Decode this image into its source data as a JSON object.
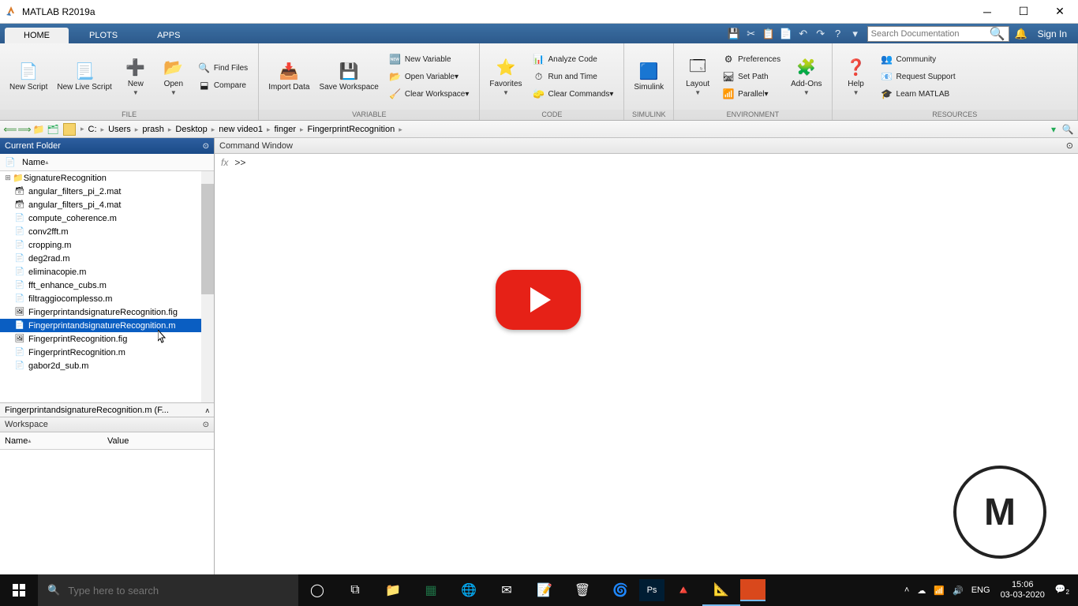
{
  "window": {
    "title": "MATLAB R2019a"
  },
  "tabs": {
    "home": "HOME",
    "plots": "PLOTS",
    "apps": "APPS"
  },
  "search": {
    "placeholder": "Search Documentation"
  },
  "signin": "Sign In",
  "ribbon": {
    "file": {
      "label": "FILE",
      "newScript": "New\nScript",
      "newLive": "New\nLive Script",
      "new": "New",
      "open": "Open",
      "findFiles": "Find Files",
      "compare": "Compare"
    },
    "variable": {
      "label": "VARIABLE",
      "importData": "Import\nData",
      "saveWs": "Save\nWorkspace",
      "newVar": "New Variable",
      "openVar": "Open Variable",
      "clearWs": "Clear Workspace"
    },
    "code": {
      "label": "CODE",
      "favorites": "Favorites",
      "analyze": "Analyze Code",
      "runTime": "Run and Time",
      "clearCmd": "Clear Commands"
    },
    "simulink": {
      "label": "SIMULINK",
      "btn": "Simulink"
    },
    "environment": {
      "label": "ENVIRONMENT",
      "layout": "Layout",
      "prefs": "Preferences",
      "setPath": "Set Path",
      "parallel": "Parallel",
      "addons": "Add-Ons"
    },
    "resources": {
      "label": "RESOURCES",
      "help": "Help",
      "community": "Community",
      "reqSupport": "Request Support",
      "learn": "Learn MATLAB"
    }
  },
  "breadcrumb": [
    "C:",
    "Users",
    "prash",
    "Desktop",
    "new video1",
    "finger",
    "FingerprintRecognition"
  ],
  "panels": {
    "currentFolder": "Current Folder",
    "nameCol": "Name",
    "detail": "FingerprintandsignatureRecognition.m  (F...",
    "workspace": "Workspace",
    "wsName": "Name",
    "wsValue": "Value",
    "commandWindow": "Command Window",
    "prompt": ">>"
  },
  "files": {
    "folder": "SignatureRecognition",
    "list": [
      "angular_filters_pi_2.mat",
      "angular_filters_pi_4.mat",
      "compute_coherence.m",
      "conv2fft.m",
      "cropping.m",
      "deg2rad.m",
      "eliminacopie.m",
      "fft_enhance_cubs.m",
      "filtraggiocomplesso.m",
      "FingerprintandsignatureRecognition.fig",
      "FingerprintandsignatureRecognition.m",
      "FingerprintRecognition.fig",
      "FingerprintRecognition.m",
      "gabor2d_sub.m"
    ],
    "selectedIndex": 10
  },
  "taskbar": {
    "searchPlaceholder": "Type here to search",
    "lang": "ENG",
    "time": "15:06",
    "date": "03-03-2020",
    "notif": "2"
  }
}
